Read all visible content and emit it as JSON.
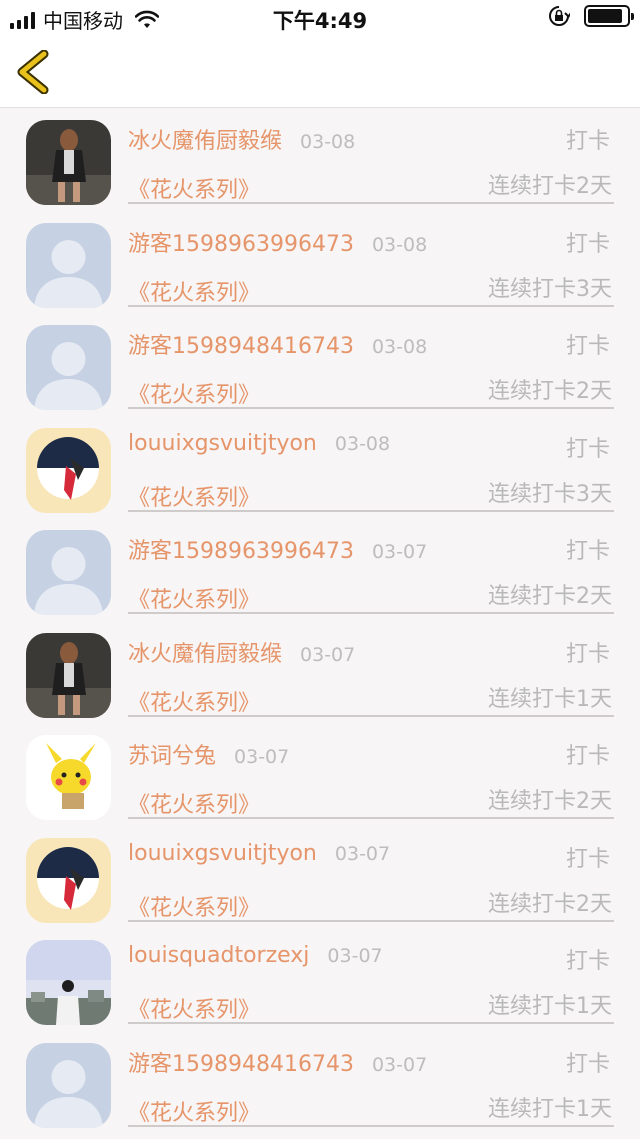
{
  "status_bar": {
    "carrier": "中国移动",
    "time": "下午4:49",
    "icons": [
      "signal-icon",
      "wifi-icon",
      "orientation-lock-icon",
      "battery-icon"
    ]
  },
  "nav": {
    "back_icon": "chevron-left-icon",
    "accent": "#e8c21a"
  },
  "colors": {
    "name": "#e6956a",
    "muted": "#b9b9b9",
    "background": "#f7f5f5"
  },
  "entries": [
    {
      "name": "冰火魔侑厨毅缑",
      "date": "03-08",
      "action": "打卡",
      "series": "《花火系列》",
      "streak": "连续打卡2天",
      "avatar": "woman-photo"
    },
    {
      "name": "游客1598963996473",
      "date": "03-08",
      "action": "打卡",
      "series": "《花火系列》",
      "streak": "连续打卡3天",
      "avatar": "default-avatar"
    },
    {
      "name": "游客1598948416743",
      "date": "03-08",
      "action": "打卡",
      "series": "《花火系列》",
      "streak": "连续打卡2天",
      "avatar": "default-avatar"
    },
    {
      "name": "louuixgsvuitjtyon",
      "date": "03-08",
      "action": "打卡",
      "series": "《花火系列》",
      "streak": "连续打卡3天",
      "avatar": "art-avatar"
    },
    {
      "name": "游客1598963996473",
      "date": "03-07",
      "action": "打卡",
      "series": "《花火系列》",
      "streak": "连续打卡2天",
      "avatar": "default-avatar"
    },
    {
      "name": "冰火魔侑厨毅缑",
      "date": "03-07",
      "action": "打卡",
      "series": "《花火系列》",
      "streak": "连续打卡1天",
      "avatar": "woman-photo"
    },
    {
      "name": "苏词兮兔",
      "date": "03-07",
      "action": "打卡",
      "series": "《花火系列》",
      "streak": "连续打卡2天",
      "avatar": "pikachu-avatar"
    },
    {
      "name": "louuixgsvuitjtyon",
      "date": "03-07",
      "action": "打卡",
      "series": "《花火系列》",
      "streak": "连续打卡2天",
      "avatar": "art-avatar"
    },
    {
      "name": "louisquadtorzexj",
      "date": "03-07",
      "action": "打卡",
      "series": "《花火系列》",
      "streak": "连续打卡1天",
      "avatar": "sky-photo"
    },
    {
      "name": "游客1598948416743",
      "date": "03-07",
      "action": "打卡",
      "series": "《花火系列》",
      "streak": "连续打卡1天",
      "avatar": "default-avatar"
    }
  ]
}
